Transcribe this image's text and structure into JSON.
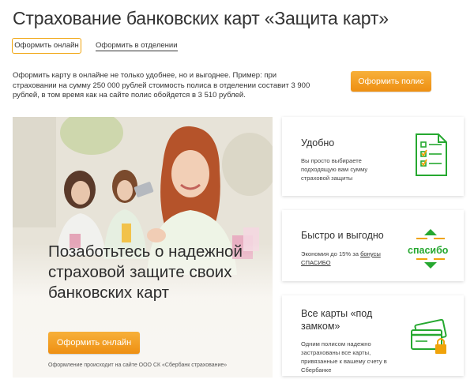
{
  "page": {
    "title": "Страхование банковских карт «Защита карт»"
  },
  "tabs": {
    "online_label": "Оформить онлайн",
    "branch_label": "Оформить в отделении"
  },
  "intro": {
    "text": "Оформить карту в онлайне не только удобнее, но и выгоднее. Пример: при страховании на сумму 250 000 рублей стоимость полиса в отделении составит 3 900 рублей, в том время как на сайте полис обойдется в 3 510 рублей.",
    "button_label": "Оформить полис"
  },
  "hero": {
    "title": "Позаботьтесь о надежной страховой защите своих банковских карт",
    "button_label": "Оформить онлайн",
    "note": "Оформление происходит на сайте ООО СК «Сбербанк страхование»"
  },
  "cards": [
    {
      "title": "Удобно",
      "text": "Вы просто выбираете подходящую вам сумму страховой защиты",
      "icon": "checklist-icon"
    },
    {
      "title": "Быстро и выгодно",
      "text_prefix": "Экономия до 15% за ",
      "link": "бонусы СПАСИБО",
      "icon_text": "спасибо",
      "icon": "spasibo-icon"
    },
    {
      "title": "Все карты «под замком»",
      "text": "Одним полисом надежно застрахованы все карты, привязанные к вашему счету в Сбербанке",
      "icon": "locked-cards-icon"
    }
  ],
  "colors": {
    "accent_orange": "#f0a30a",
    "green": "#26a830"
  }
}
